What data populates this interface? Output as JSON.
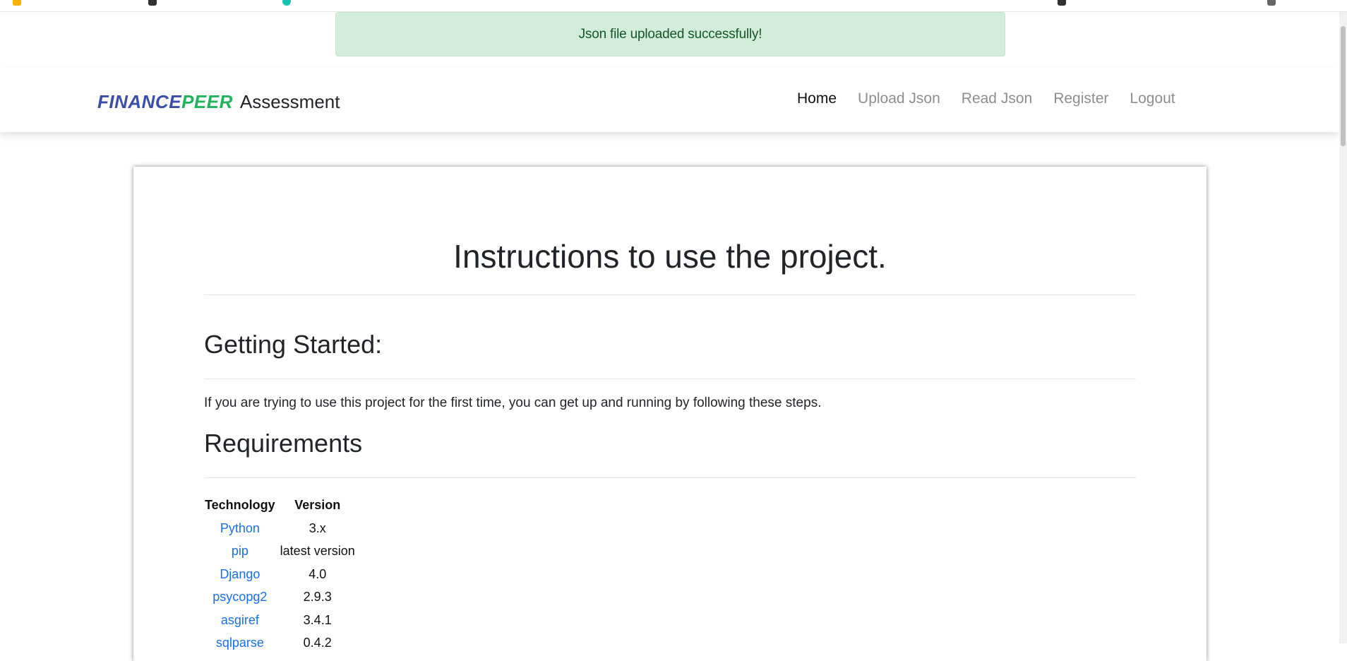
{
  "alert": {
    "message": "Json file uploaded successfully!"
  },
  "navbar": {
    "brand_part1": "FINANCE",
    "brand_part2": "PEER",
    "brand_sub": "Assessment",
    "links": [
      {
        "label": "Home",
        "active": true
      },
      {
        "label": "Upload Json",
        "active": false
      },
      {
        "label": "Read Json",
        "active": false
      },
      {
        "label": "Register",
        "active": false
      },
      {
        "label": "Logout",
        "active": false
      }
    ]
  },
  "main": {
    "title": "Instructions to use the project.",
    "getting_started_heading": "Getting Started:",
    "getting_started_text": "If you are trying to use this project for the first time, you can get up and running by following these steps.",
    "requirements_heading": "Requirements",
    "requirements_table": {
      "headers": [
        "Technology",
        "Version"
      ],
      "rows": [
        {
          "technology": "Python",
          "version": "3.x"
        },
        {
          "technology": "pip",
          "version": "latest version"
        },
        {
          "technology": "Django",
          "version": "4.0"
        },
        {
          "technology": "psycopg2",
          "version": "2.9.3"
        },
        {
          "technology": "asgiref",
          "version": "3.4.1"
        },
        {
          "technology": "sqlparse",
          "version": "0.4.2"
        }
      ]
    }
  },
  "colors": {
    "brand_blue": "#3a4fa8",
    "brand_green": "#22b35a",
    "link_blue": "#1a6fe8",
    "alert_bg": "#d4edda",
    "alert_text": "#155724",
    "nav_inactive": "#8d8d8d"
  }
}
